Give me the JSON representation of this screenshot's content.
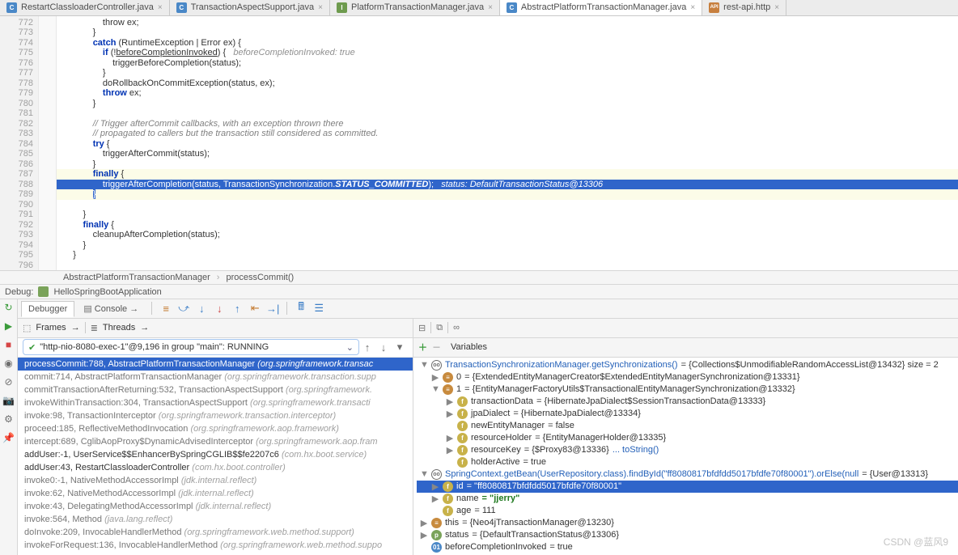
{
  "tabs": [
    {
      "icon": "C",
      "cls": "ic-c",
      "label": "RestartClassloaderController.java",
      "active": false
    },
    {
      "icon": "C",
      "cls": "ic-c",
      "label": "TransactionAspectSupport.java",
      "active": false
    },
    {
      "icon": "I",
      "cls": "ic-i",
      "label": "PlatformTransactionManager.java",
      "active": false
    },
    {
      "icon": "C",
      "cls": "ic-c",
      "label": "AbstractPlatformTransactionManager.java",
      "active": true
    },
    {
      "icon": "API",
      "cls": "ic-http",
      "label": "rest-api.http",
      "active": false
    }
  ],
  "lines": {
    "start": 772,
    "end": 796
  },
  "code": [
    {
      "n": 772,
      "txt": "                throw ex;"
    },
    {
      "n": 773,
      "txt": "            }"
    },
    {
      "n": 774,
      "html": "            <span class='kw'>catch</span> (RuntimeException | Error ex) {"
    },
    {
      "n": 775,
      "html": "                <span class='kw'>if</span> (!<u>beforeCompletionInvoked</u>) {   <span class='hint'>beforeCompletionInvoked: true</span>"
    },
    {
      "n": 776,
      "txt": "                    triggerBeforeCompletion(status);"
    },
    {
      "n": 777,
      "txt": "                }"
    },
    {
      "n": 778,
      "txt": "                doRollbackOnCommitException(status, ex);"
    },
    {
      "n": 779,
      "html": "                <span class='kw'>throw</span> ex;"
    },
    {
      "n": 780,
      "txt": "            }"
    },
    {
      "n": 781,
      "txt": ""
    },
    {
      "n": 782,
      "html": "            <span class='cmt'>// Trigger afterCommit callbacks, with an exception thrown there</span>"
    },
    {
      "n": 783,
      "html": "            <span class='cmt'>// propagated to callers but the transaction still considered as committed.</span>"
    },
    {
      "n": 784,
      "html": "            <span class='kw'>try</span> {"
    },
    {
      "n": 785,
      "txt": "                triggerAfterCommit(status);"
    },
    {
      "n": 786,
      "txt": "            }"
    },
    {
      "n": 787,
      "html": "            <span class='kw'>finally</span> {",
      "hl": true
    },
    {
      "n": 788,
      "html": "                triggerAfterCompletion(status, TransactionSynchronization.<span class='static'>STATUS_COMMITTED</span>);   <span class='hint'>status: DefaultTransactionStatus@13306</span>",
      "sel": true
    },
    {
      "n": 789,
      "html": "            <span style='background:#2f65ca;color:#fff'>}</span>",
      "hl": true
    },
    {
      "n": 790,
      "txt": ""
    },
    {
      "n": 791,
      "txt": "        }"
    },
    {
      "n": 792,
      "html": "        <span class='kw'>finally</span> {"
    },
    {
      "n": 793,
      "txt": "            cleanupAfterCompletion(status);"
    },
    {
      "n": 794,
      "txt": "        }"
    },
    {
      "n": 795,
      "txt": "    }"
    },
    {
      "n": 796,
      "txt": ""
    }
  ],
  "breadcrumb": {
    "class": "AbstractPlatformTransactionManager",
    "method": "processCommit()"
  },
  "debug": {
    "label": "Debug:",
    "config": "HelloSpringBootApplication"
  },
  "dbgTabs": {
    "debugger": "Debugger",
    "console": "Console"
  },
  "frames": {
    "hdr_frames": "Frames",
    "hdr_threads": "Threads",
    "thread": "\"http-nio-8080-exec-1\"@9,196 in group \"main\": RUNNING"
  },
  "frameList": [
    {
      "main": "processCommit:788, AbstractPlatformTransactionManager",
      "pkg": "(org.springframework.transac",
      "active": true,
      "dark": true
    },
    {
      "main": "commit:714, AbstractPlatformTransactionManager",
      "pkg": "(org.springframework.transaction.supp"
    },
    {
      "main": "commitTransactionAfterReturning:532, TransactionAspectSupport",
      "pkg": "(org.springframework."
    },
    {
      "main": "invokeWithinTransaction:304, TransactionAspectSupport",
      "pkg": "(org.springframework.transacti"
    },
    {
      "main": "invoke:98, TransactionInterceptor",
      "pkg": "(org.springframework.transaction.interceptor)"
    },
    {
      "main": "proceed:185, ReflectiveMethodInvocation",
      "pkg": "(org.springframework.aop.framework)"
    },
    {
      "main": "intercept:689, CglibAopProxy$DynamicAdvisedInterceptor",
      "pkg": "(org.springframework.aop.fram"
    },
    {
      "main": "addUser:-1, UserService$$EnhancerBySpringCGLIB$$fe2207c6",
      "pkg": "(com.hx.boot.service)",
      "dark": true
    },
    {
      "main": "addUser:43, RestartClassloaderController",
      "pkg": "(com.hx.boot.controller)",
      "dark": true
    },
    {
      "main": "invoke0:-1, NativeMethodAccessorImpl",
      "pkg": "(jdk.internal.reflect)"
    },
    {
      "main": "invoke:62, NativeMethodAccessorImpl",
      "pkg": "(jdk.internal.reflect)"
    },
    {
      "main": "invoke:43, DelegatingMethodAccessorImpl",
      "pkg": "(jdk.internal.reflect)"
    },
    {
      "main": "invoke:564, Method",
      "pkg": "(java.lang.reflect)"
    },
    {
      "main": "doInvoke:209, InvocableHandlerMethod",
      "pkg": "(org.springframework.web.method.support)"
    },
    {
      "main": "invokeForRequest:136, InvocableHandlerMethod",
      "pkg": "(org.springframework.web.method.suppo"
    }
  ],
  "vars": {
    "hdr": "Variables",
    "watch1": "TransactionSynchronizationManager.getSynchronizations()",
    "watch1_val": "= {Collections$UnmodifiableRandomAccessList@13432}  size = 2",
    "i0": "0",
    "i0_val": "= {ExtendedEntityManagerCreator$ExtendedEntityManagerSynchronization@13331}",
    "i1": "1",
    "i1_val": "= {EntityManagerFactoryUtils$TransactionalEntityManagerSynchronization@13332}",
    "td": "transactionData",
    "td_val": "= {HibernateJpaDialect$SessionTransactionData@13333}",
    "jd": "jpaDialect",
    "jd_val": "= {HibernateJpaDialect@13334}",
    "nem": "newEntityManager",
    "nem_val": "= false",
    "rh": "resourceHolder",
    "rh_val": "= {EntityManagerHolder@13335}",
    "rk": "resourceKey",
    "rk_val": "= {$Proxy83@13336}",
    "rk_link": "... toString()",
    "ha": "holderActive",
    "ha_val": "= true",
    "watch2": "SpringContext.getBean(UserRepository.class).findById(\"ff8080817bfdfdd5017bfdfe70f80001\").orElse(null",
    "watch2_val": "= {User@13313}",
    "id": "id",
    "id_val": "= \"ff8080817bfdfdd5017bfdfe70f80001\"",
    "name": "name",
    "name_val": "= \"jjerry\"",
    "age": "age",
    "age_val": "= 111",
    "this": "this",
    "this_val": "= {Neo4jTransactionManager@13230}",
    "status": "status",
    "status_val": "= {DefaultTransactionStatus@13306}",
    "bci": "beforeCompletionInvoked",
    "bci_val": "= true"
  },
  "watermark": "CSDN @蓝风9"
}
